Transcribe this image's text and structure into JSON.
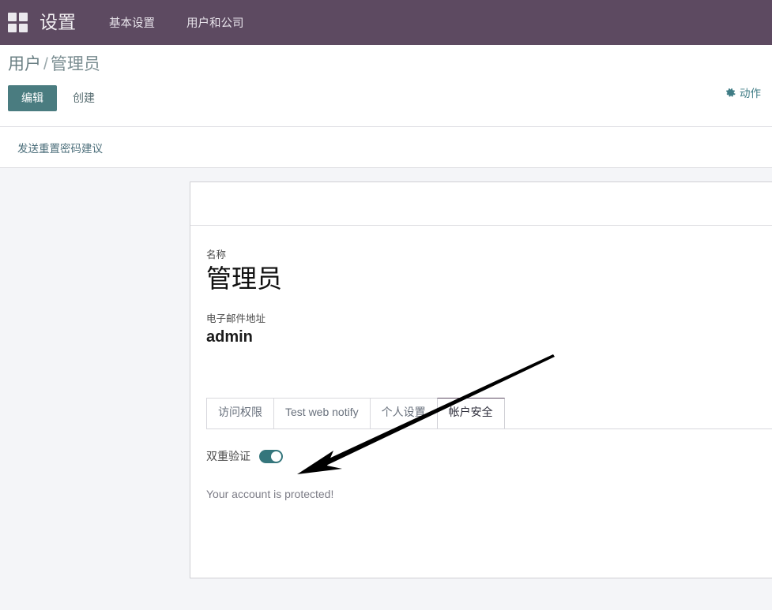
{
  "navbar": {
    "apps_icon": "apps-grid-icon",
    "brand": "设置",
    "items": [
      {
        "label": "基本设置"
      },
      {
        "label": "用户和公司"
      }
    ]
  },
  "control_panel": {
    "breadcrumb": {
      "root": "用户",
      "separator": "/",
      "current": "管理员"
    },
    "edit_label": "编辑",
    "create_label": "创建",
    "actions_label": "动作",
    "actions_icon": "gear-icon"
  },
  "sub_bar": {
    "send_password_reset_label": "发送重置密码建议"
  },
  "form": {
    "name_label": "名称",
    "name_value": "管理员",
    "email_label": "电子邮件地址",
    "email_value": "admin"
  },
  "notebook": {
    "tabs": [
      {
        "label": "访问权限",
        "active": false
      },
      {
        "label": "Test web notify",
        "active": false
      },
      {
        "label": "个人设置",
        "active": false
      },
      {
        "label": "帐户安全",
        "active": true
      }
    ],
    "account_security": {
      "two_factor_label": "双重验证",
      "two_factor_enabled": true,
      "status_text": "Your account is protected!"
    }
  },
  "colors": {
    "navbar_bg": "#5d4a61",
    "primary_button": "#4a7c80",
    "breadcrumb_text": "#6a7f83",
    "accent_link": "#3f7c85",
    "switch_on": "#35767c",
    "page_bg": "#f4f5f8",
    "annotation_arrow": "#000000"
  }
}
